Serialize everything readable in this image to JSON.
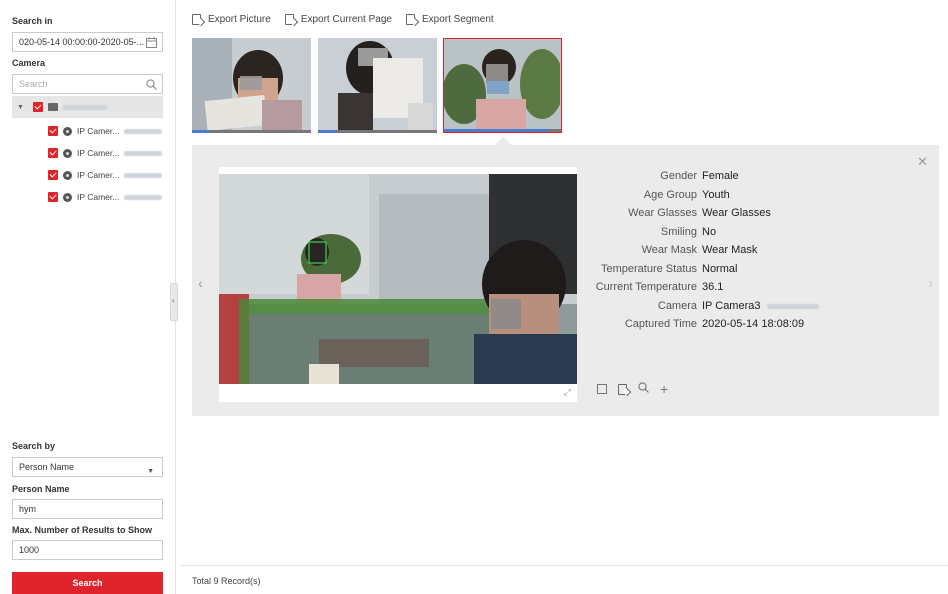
{
  "left_panel": {
    "search_in_label": "Search in",
    "time_range": "020-05-14 00:00:00-2020-05-...",
    "camera_label": "Camera",
    "camera_search_placeholder": "Search",
    "cameras": [
      {
        "label": "IP Camer..."
      },
      {
        "label": "IP Camer..."
      },
      {
        "label": "IP Camer..."
      },
      {
        "label": "IP Camer..."
      }
    ],
    "search_by_label": "Search by",
    "search_by_value": "Person Name",
    "person_name_label": "Person Name",
    "person_name_value": "hym",
    "max_results_label": "Max. Number of Results to Show",
    "max_results_value": "1000",
    "search_button": "Search"
  },
  "toolbar": {
    "export_picture": "Export Picture",
    "export_current_page": "Export Current Page",
    "export_segment": "Export Segment"
  },
  "thumbnails": [
    {
      "selected": false,
      "progress": 0.15
    },
    {
      "selected": false,
      "progress": 0.15
    },
    {
      "selected": true,
      "progress": 0.9
    }
  ],
  "detail": {
    "attributes": [
      {
        "key": "Gender",
        "value": "Female"
      },
      {
        "key": "Age Group",
        "value": "Youth"
      },
      {
        "key": "Wear Glasses",
        "value": "Wear Glasses"
      },
      {
        "key": "Smiling",
        "value": "No"
      },
      {
        "key": "Wear Mask",
        "value": "Wear Mask"
      },
      {
        "key": "Temperature Status",
        "value": "Normal"
      },
      {
        "key": "Current Temperature",
        "value": "36.1"
      },
      {
        "key": "Camera",
        "value": "IP Camera3"
      },
      {
        "key": "Captured Time",
        "value": "2020-05-14 18:08:09"
      }
    ]
  },
  "footer": {
    "total_records": "Total 9 Record(s)"
  },
  "colors": {
    "accent": "#e0242b",
    "detail_bg": "#ebebeb",
    "face_box": "#3fd14f"
  }
}
